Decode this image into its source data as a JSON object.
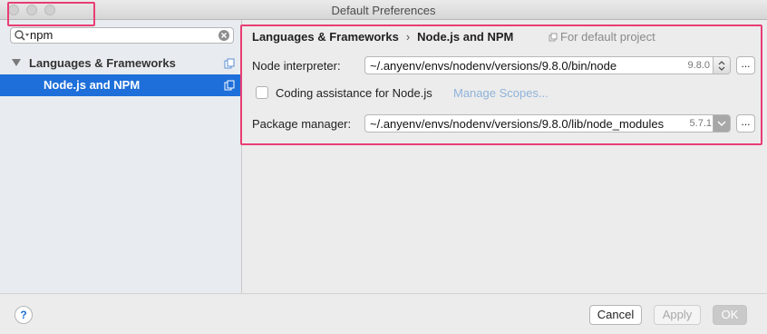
{
  "window": {
    "title": "Default Preferences"
  },
  "search": {
    "value": "npm"
  },
  "tree": {
    "items": [
      {
        "label": "Languages & Frameworks"
      },
      {
        "label": "Node.js and NPM"
      }
    ]
  },
  "breadcrumb": {
    "parent": "Languages & Frameworks",
    "separator": "›",
    "current": "Node.js and NPM",
    "scope": "For default project"
  },
  "node_interpreter": {
    "label": "Node interpreter:",
    "value": "~/.anyenv/envs/nodenv/versions/9.8.0/bin/node",
    "version": "9.8.0",
    "browse_label": "..."
  },
  "coding_assistance": {
    "label": "Coding assistance for Node.js",
    "checked": false,
    "manage_scopes_label": "Manage Scopes..."
  },
  "package_manager": {
    "label": "Package manager:",
    "value": "~/.anyenv/envs/nodenv/versions/9.8.0/lib/node_modules",
    "version": "5.7.1",
    "browse_label": "..."
  },
  "footer": {
    "help_label": "?",
    "cancel_label": "Cancel",
    "apply_label": "Apply",
    "ok_label": "OK"
  },
  "colors": {
    "selection": "#1e6fd9",
    "highlight": "#e83e74",
    "link": "#8fb3d9"
  }
}
